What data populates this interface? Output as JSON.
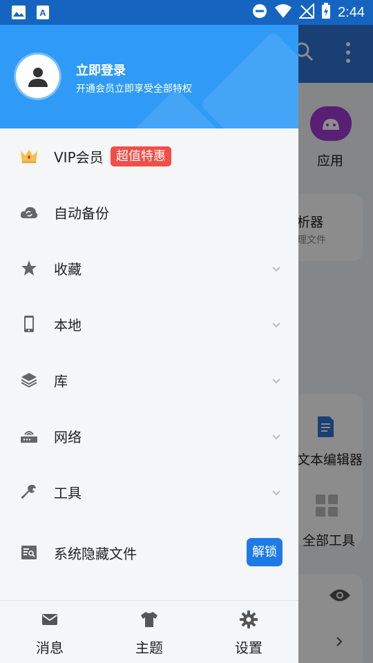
{
  "status_bar": {
    "time": "2:44",
    "left_icons": [
      "image-icon",
      "text-app-icon"
    ],
    "right_icons": [
      "do-not-disturb-icon",
      "wifi-icon",
      "no-signal-icon",
      "battery-charging-icon"
    ]
  },
  "drawer": {
    "header": {
      "title": "立即登录",
      "subtitle": "开通会员立即享受全部特权"
    },
    "menu_items": [
      {
        "label": "VIP会员",
        "icon": "crown-icon",
        "badge": "超值特惠"
      },
      {
        "label": "自动备份",
        "icon": "cloud-sync-icon"
      },
      {
        "label": "收藏",
        "icon": "star-icon"
      },
      {
        "label": "本地",
        "icon": "phone-icon"
      },
      {
        "label": "库",
        "icon": "layers-icon"
      },
      {
        "label": "网络",
        "icon": "router-icon"
      },
      {
        "label": "工具",
        "icon": "wrench-icon"
      },
      {
        "label": "系统隐藏文件",
        "icon": "hidden-file-icon",
        "button": "解锁"
      }
    ],
    "bottom_tabs": [
      {
        "label": "消息",
        "icon": "mail-icon"
      },
      {
        "label": "主题",
        "icon": "shirt-icon"
      },
      {
        "label": "设置",
        "icon": "gear-icon"
      }
    ]
  },
  "background": {
    "app_label": "应用",
    "analyzer_title": "析器",
    "analyzer_sub": "理文件",
    "text_editor": "文本编辑器",
    "all_tools": "全部工具"
  },
  "colors": {
    "drawer_header": "#2f9bf6",
    "vip_badge": "#f24e47",
    "unlock_button": "#1e7be6",
    "background_header": "#2f74d6"
  }
}
